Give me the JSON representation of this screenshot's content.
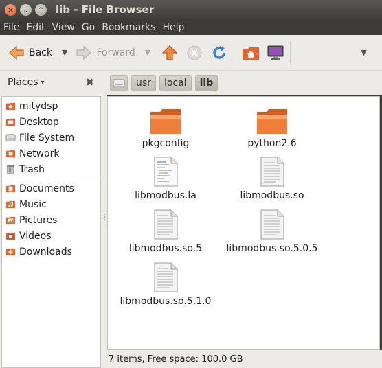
{
  "window": {
    "title": "lib - File Browser",
    "buttons": {
      "close": "×",
      "minimize": "⌄",
      "maximize": "⌃"
    }
  },
  "menubar": {
    "items": [
      "File",
      "Edit",
      "View",
      "Go",
      "Bookmarks",
      "Help"
    ]
  },
  "toolbar": {
    "back_label": "Back",
    "forward_label": "Forward",
    "dropdown_arrow": "▼",
    "overflow_arrow": "▼"
  },
  "sidebar": {
    "header_label": "Places",
    "header_arrow": "▾",
    "close_glyph": "✖",
    "items": [
      {
        "label": "mitydsp",
        "icon": "home-folder-icon"
      },
      {
        "label": "Desktop",
        "icon": "desktop-folder-icon"
      },
      {
        "label": "File System",
        "icon": "drive-icon"
      },
      {
        "label": "Network",
        "icon": "network-icon"
      },
      {
        "label": "Trash",
        "icon": "trash-icon"
      },
      {
        "label": "Documents",
        "icon": "folder-icon"
      },
      {
        "label": "Music",
        "icon": "music-folder-icon"
      },
      {
        "label": "Pictures",
        "icon": "pictures-folder-icon"
      },
      {
        "label": "Videos",
        "icon": "videos-folder-icon"
      },
      {
        "label": "Downloads",
        "icon": "downloads-folder-icon"
      }
    ]
  },
  "pathbar": {
    "crumbs": [
      "usr",
      "local",
      "lib"
    ]
  },
  "files": [
    {
      "name": "pkgconfig",
      "type": "folder"
    },
    {
      "name": "python2.6",
      "type": "folder"
    },
    {
      "name": "libmodbus.la",
      "type": "script"
    },
    {
      "name": "libmodbus.so",
      "type": "file"
    },
    {
      "name": "libmodbus.so.5",
      "type": "file"
    },
    {
      "name": "libmodbus.so.5.0.5",
      "type": "file"
    },
    {
      "name": "libmodbus.so.5.1.0",
      "type": "file"
    }
  ],
  "status": {
    "text": "7 items, Free space: 100.0 GB"
  },
  "colors": {
    "folder_orange": "#e8642a",
    "accent": "#dd4814",
    "titlebar": "#3c3b37"
  }
}
